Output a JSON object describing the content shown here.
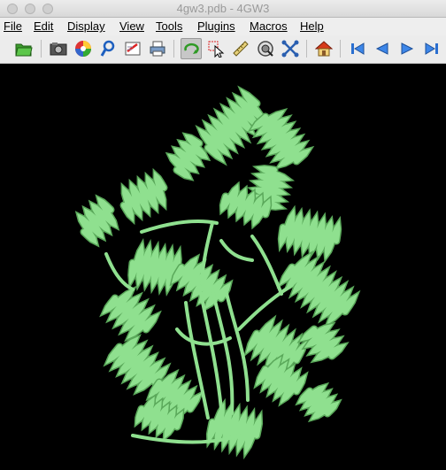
{
  "window": {
    "title": "4gw3.pdb - 4GW3"
  },
  "menu": {
    "file": "File",
    "edit": "Edit",
    "display": "Display",
    "view": "View",
    "tools": "Tools",
    "plugins": "Plugins",
    "macros": "Macros",
    "help": "Help"
  },
  "toolbar": {
    "buttons": [
      {
        "icon": "open-folder-icon"
      },
      {
        "icon": "camera-icon"
      },
      {
        "icon": "color-wheel-icon"
      },
      {
        "icon": "magnifier-icon"
      },
      {
        "icon": "preferences-icon"
      },
      {
        "icon": "print-icon"
      },
      {
        "icon": "rotate-icon",
        "pressed": true
      },
      {
        "icon": "select-pointer-icon"
      },
      {
        "icon": "ruler-icon"
      },
      {
        "icon": "zoom-icon"
      },
      {
        "icon": "pick-atoms-icon"
      },
      {
        "icon": "home-icon"
      },
      {
        "icon": "first-frame-icon"
      },
      {
        "icon": "previous-frame-icon"
      },
      {
        "icon": "next-frame-icon"
      },
      {
        "icon": "last-frame-icon"
      }
    ]
  },
  "viewer": {
    "background": "#000000",
    "ribbon_color": "#8fe08f",
    "ribbon_shade": "#5aa85a"
  }
}
